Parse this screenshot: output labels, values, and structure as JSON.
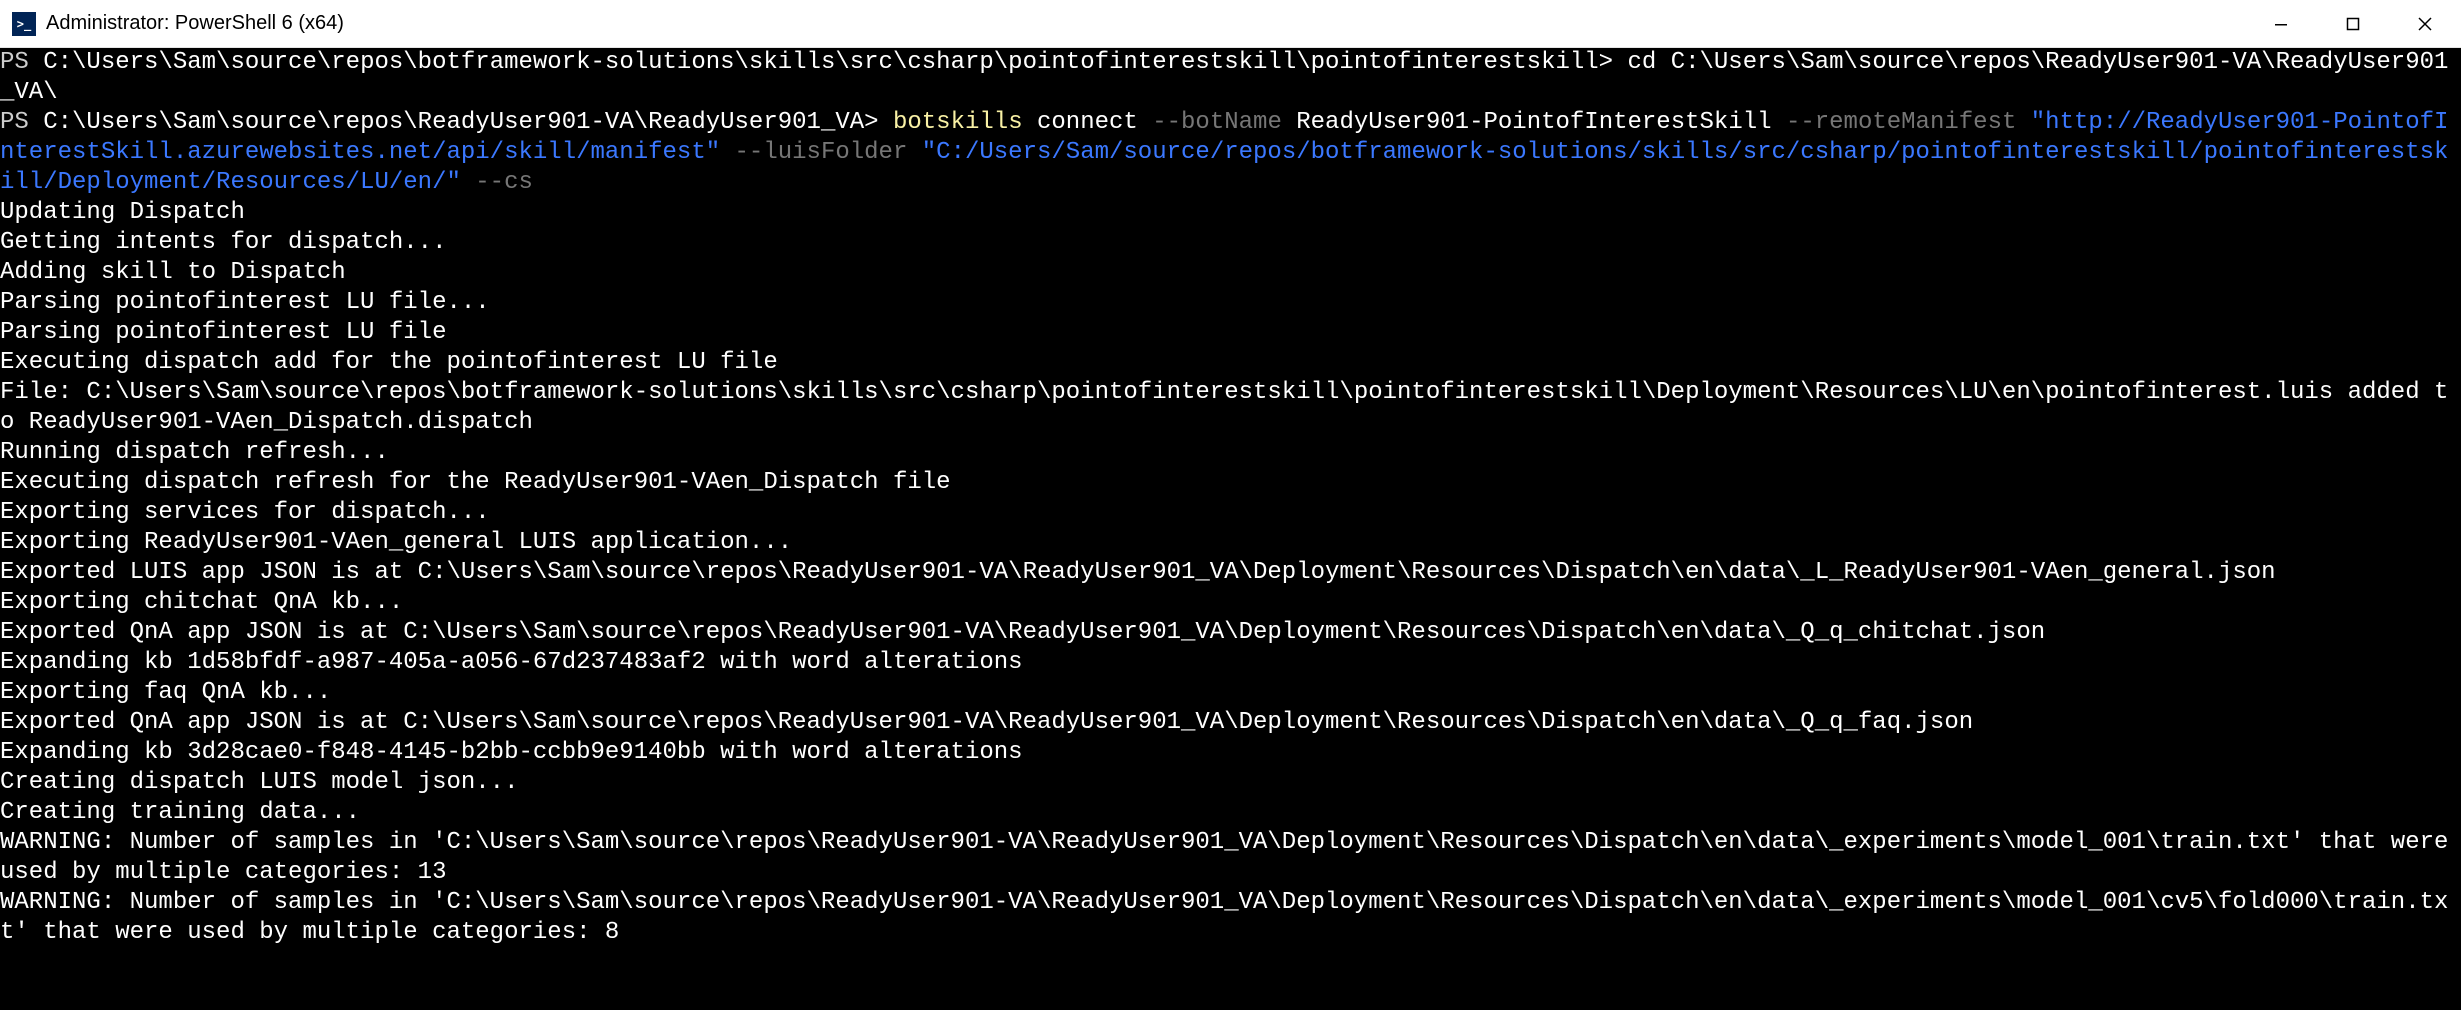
{
  "window": {
    "title": "Administrator: PowerShell 6 (x64)"
  },
  "lines": [
    {
      "segments": [
        {
          "text": "PS ",
          "cls": "c-gray"
        },
        {
          "text": "C:\\Users\\Sam\\source\\repos\\botframework-solutions\\skills\\src\\csharp\\pointofinterestskill\\pointofinterestskill> ",
          "cls": "c-white"
        },
        {
          "text": "cd C:\\Users\\Sam\\source\\repos\\ReadyUser901-VA\\ReadyUser901_VA\\",
          "cls": "c-white"
        }
      ]
    },
    {
      "segments": [
        {
          "text": "PS ",
          "cls": "c-gray"
        },
        {
          "text": "C:\\Users\\Sam\\source\\repos\\ReadyUser901-VA\\ReadyUser901_VA> ",
          "cls": "c-white"
        },
        {
          "text": "botskills ",
          "cls": "c-yellow"
        },
        {
          "text": "connect ",
          "cls": "c-white"
        },
        {
          "text": "--botName ",
          "cls": "c-dgray"
        },
        {
          "text": "ReadyUser901-PointofInterestSkill ",
          "cls": "c-white"
        },
        {
          "text": "--remoteManifest ",
          "cls": "c-dgray"
        },
        {
          "text": "\"http://ReadyUser901-PointofInterestSkill.azurewebsites.net/api/skill/manifest\" ",
          "cls": "c-blue"
        },
        {
          "text": "--luisFolder ",
          "cls": "c-dgray"
        },
        {
          "text": "\"C:/Users/Sam/source/repos/botframework-solutions/skills/src/csharp/pointofinterestskill/pointofinterestskill/Deployment/Resources/LU/en/\" ",
          "cls": "c-blue"
        },
        {
          "text": "--cs",
          "cls": "c-dgray"
        }
      ]
    },
    {
      "segments": [
        {
          "text": "Updating Dispatch",
          "cls": "c-white"
        }
      ]
    },
    {
      "segments": [
        {
          "text": "Getting intents for dispatch...",
          "cls": "c-white"
        }
      ]
    },
    {
      "segments": [
        {
          "text": "Adding skill to Dispatch",
          "cls": "c-white"
        }
      ]
    },
    {
      "segments": [
        {
          "text": "Parsing pointofinterest LU file...",
          "cls": "c-white"
        }
      ]
    },
    {
      "segments": [
        {
          "text": "Parsing pointofinterest LU file",
          "cls": "c-white"
        }
      ]
    },
    {
      "segments": [
        {
          "text": "Executing dispatch add for the pointofinterest LU file",
          "cls": "c-white"
        }
      ]
    },
    {
      "segments": [
        {
          "text": "File: C:\\Users\\Sam\\source\\repos\\botframework-solutions\\skills\\src\\csharp\\pointofinterestskill\\pointofinterestskill\\Deployment\\Resources\\LU\\en\\pointofinterest.luis added to ReadyUser901-VAen_Dispatch.dispatch",
          "cls": "c-white"
        }
      ]
    },
    {
      "segments": [
        {
          "text": "Running dispatch refresh...",
          "cls": "c-white"
        }
      ]
    },
    {
      "segments": [
        {
          "text": "Executing dispatch refresh for the ReadyUser901-VAen_Dispatch file",
          "cls": "c-white"
        }
      ]
    },
    {
      "segments": [
        {
          "text": "Exporting services for dispatch...",
          "cls": "c-white"
        }
      ]
    },
    {
      "segments": [
        {
          "text": "Exporting ReadyUser901-VAen_general LUIS application...",
          "cls": "c-white"
        }
      ]
    },
    {
      "segments": [
        {
          "text": "Exported LUIS app JSON is at C:\\Users\\Sam\\source\\repos\\ReadyUser901-VA\\ReadyUser901_VA\\Deployment\\Resources\\Dispatch\\en\\data\\_L_ReadyUser901-VAen_general.json",
          "cls": "c-white"
        }
      ]
    },
    {
      "segments": [
        {
          "text": "Exporting chitchat QnA kb...",
          "cls": "c-white"
        }
      ]
    },
    {
      "segments": [
        {
          "text": "Exported QnA app JSON is at C:\\Users\\Sam\\source\\repos\\ReadyUser901-VA\\ReadyUser901_VA\\Deployment\\Resources\\Dispatch\\en\\data\\_Q_q_chitchat.json",
          "cls": "c-white"
        }
      ]
    },
    {
      "segments": [
        {
          "text": "Expanding kb 1d58bfdf-a987-405a-a056-67d237483af2 with word alterations",
          "cls": "c-white"
        }
      ]
    },
    {
      "segments": [
        {
          "text": "Exporting faq QnA kb...",
          "cls": "c-white"
        }
      ]
    },
    {
      "segments": [
        {
          "text": "Exported QnA app JSON is at C:\\Users\\Sam\\source\\repos\\ReadyUser901-VA\\ReadyUser901_VA\\Deployment\\Resources\\Dispatch\\en\\data\\_Q_q_faq.json",
          "cls": "c-white"
        }
      ]
    },
    {
      "segments": [
        {
          "text": "Expanding kb 3d28cae0-f848-4145-b2bb-ccbb9e9140bb with word alterations",
          "cls": "c-white"
        }
      ]
    },
    {
      "segments": [
        {
          "text": "Creating dispatch LUIS model json...",
          "cls": "c-white"
        }
      ]
    },
    {
      "segments": [
        {
          "text": "Creating training data...",
          "cls": "c-white"
        }
      ]
    },
    {
      "segments": [
        {
          "text": "WARNING: Number of samples in 'C:\\Users\\Sam\\source\\repos\\ReadyUser901-VA\\ReadyUser901_VA\\Deployment\\Resources\\Dispatch\\en\\data\\_experiments\\model_001\\train.txt' that were used by multiple categories: 13",
          "cls": "c-white"
        }
      ]
    },
    {
      "segments": [
        {
          "text": "WARNING: Number of samples in 'C:\\Users\\Sam\\source\\repos\\ReadyUser901-VA\\ReadyUser901_VA\\Deployment\\Resources\\Dispatch\\en\\data\\_experiments\\model_001\\cv5\\fold000\\train.txt' that were used by multiple categories: 8",
          "cls": "c-white"
        }
      ]
    }
  ]
}
